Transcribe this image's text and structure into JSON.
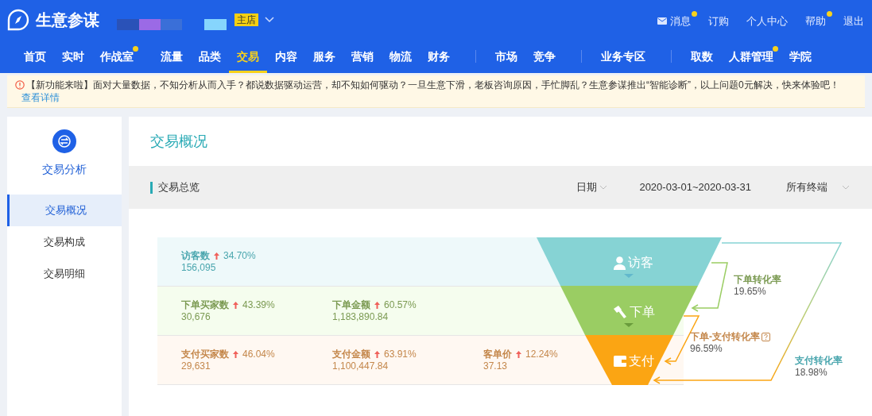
{
  "header": {
    "logo_text": "生意参谋",
    "store_badge": "主店",
    "top_links": [
      {
        "label": "消息",
        "dot": true,
        "kind": "mail"
      },
      {
        "label": "订购",
        "dot": false,
        "kind": "plain"
      },
      {
        "label": "个人中心",
        "dot": false,
        "kind": "plain"
      },
      {
        "label": "帮助",
        "dot": true,
        "kind": "plain"
      },
      {
        "label": "退出",
        "dot": false,
        "kind": "plain"
      }
    ]
  },
  "nav": [
    {
      "label": "首页",
      "selected": false,
      "dot": false,
      "group_start": false,
      "divider": false
    },
    {
      "label": "实时",
      "selected": false,
      "dot": false,
      "group_start": false,
      "divider": false
    },
    {
      "label": "作战室",
      "selected": false,
      "dot": true,
      "group_start": false,
      "divider": false
    },
    {
      "label": "流量",
      "selected": false,
      "dot": false,
      "group_start": true,
      "divider": false
    },
    {
      "label": "品类",
      "selected": false,
      "dot": false,
      "group_start": false,
      "divider": false
    },
    {
      "label": "交易",
      "selected": true,
      "dot": false,
      "group_start": false,
      "divider": false
    },
    {
      "label": "内容",
      "selected": false,
      "dot": false,
      "group_start": false,
      "divider": false
    },
    {
      "label": "服务",
      "selected": false,
      "dot": false,
      "group_start": false,
      "divider": false
    },
    {
      "label": "营销",
      "selected": false,
      "dot": false,
      "group_start": false,
      "divider": false
    },
    {
      "label": "物流",
      "selected": false,
      "dot": false,
      "group_start": false,
      "divider": false
    },
    {
      "label": "财务",
      "selected": false,
      "dot": false,
      "group_start": false,
      "divider": false
    },
    {
      "label": "市场",
      "selected": false,
      "dot": false,
      "group_start": true,
      "divider": true
    },
    {
      "label": "竞争",
      "selected": false,
      "dot": false,
      "group_start": false,
      "divider": false
    },
    {
      "label": "业务专区",
      "selected": false,
      "dot": false,
      "group_start": true,
      "divider": true
    },
    {
      "label": "取数",
      "selected": false,
      "dot": false,
      "group_start": true,
      "divider": true
    },
    {
      "label": "人群管理",
      "selected": false,
      "dot": true,
      "group_start": false,
      "divider": false
    },
    {
      "label": "学院",
      "selected": false,
      "dot": false,
      "group_start": false,
      "divider": false
    }
  ],
  "notice": {
    "text": "【新功能来啦】面对大量数据，不知分析从而入手？都说数据驱动运营，却不知如何驱动？一旦生意下滑，老板咨询原因，手忙脚乱？生意参谋推出“智能诊断”，以上问题0元解决，快来体验吧！",
    "link": "查看详情"
  },
  "sidebar": {
    "title": "交易分析",
    "items": [
      {
        "label": "交易概况",
        "selected": true
      },
      {
        "label": "交易构成",
        "selected": false
      },
      {
        "label": "交易明细",
        "selected": false
      }
    ]
  },
  "page_title": "交易概况",
  "summary": {
    "title": "交易总览",
    "date_label": "日期",
    "date_range": "2020-03-01~2020-03-31",
    "terminal": "所有终端"
  },
  "funnel": {
    "rows": [
      {
        "kind": "visitor",
        "stage": "访客",
        "metrics": [
          {
            "label": "访客数",
            "change": "34.70%",
            "value": "156,095"
          }
        ]
      },
      {
        "kind": "order",
        "stage": "下单",
        "metrics": [
          {
            "label": "下单买家数",
            "change": "43.39%",
            "value": "30,676"
          },
          {
            "label": "下单金额",
            "change": "60.57%",
            "value": "1,183,890.84"
          }
        ]
      },
      {
        "kind": "payment",
        "stage": "支付",
        "metrics": [
          {
            "label": "支付买家数",
            "change": "46.04%",
            "value": "29,631"
          },
          {
            "label": "支付金额",
            "change": "63.91%",
            "value": "1,100,447.84"
          },
          {
            "label": "客单价",
            "change": "12.24%",
            "value": "37.13"
          }
        ]
      }
    ],
    "rates": [
      {
        "kind": "order",
        "label": "下单转化率",
        "value": "19.65%",
        "help": false
      },
      {
        "kind": "payment",
        "label": "下单-支付转化率",
        "value": "96.59%",
        "help": true
      },
      {
        "kind": "visitor",
        "label": "支付转化率",
        "value": "18.98%",
        "help": false
      }
    ]
  }
}
